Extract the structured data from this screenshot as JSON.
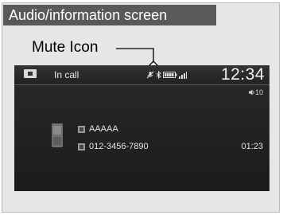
{
  "header": {
    "title": "Audio/information screen"
  },
  "callout": {
    "label": "Mute Icon"
  },
  "status_bar": {
    "call_status": "In call",
    "clock": "12:34",
    "icons": [
      "phone-tab-icon",
      "mute-icon",
      "bluetooth-icon",
      "battery-icon",
      "signal-icon"
    ]
  },
  "volume": {
    "level": "10"
  },
  "call": {
    "name": "AAAAA",
    "number": "012-3456-7890",
    "duration": "01:23"
  },
  "colors": {
    "header_bg": "#58595b",
    "screen_bg": "#222222",
    "text": "#e6e6e6"
  }
}
